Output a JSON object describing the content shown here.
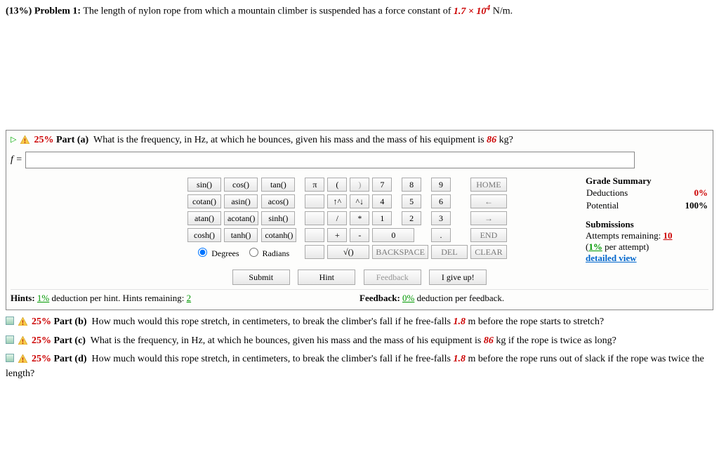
{
  "problem": {
    "weight": "(13%)",
    "label": "Problem 1:",
    "text_before": "The length of nylon rope from which a mountain climber is suspended has a force constant of",
    "constant": "1.7 × 10",
    "constant_exp": "4",
    "text_after": "N/m."
  },
  "part_a": {
    "pct": "25%",
    "label": "Part (a)",
    "question_before": "What is the frequency, in Hz, at which he bounces, given his mass and the mass of his equipment is",
    "mass": "86",
    "question_after": "kg?",
    "lhs": "f =",
    "input_value": ""
  },
  "fn_buttons": [
    [
      "sin()",
      "cos()",
      "tan()"
    ],
    [
      "cotan()",
      "asin()",
      "acos()"
    ],
    [
      "atan()",
      "acotan()",
      "sinh()"
    ],
    [
      "cosh()",
      "tanh()",
      "cotanh()"
    ]
  ],
  "deg_label": "Degrees",
  "rad_label": "Radians",
  "sym_col": [
    "π",
    "",
    "",
    "+"
  ],
  "paren_col": [
    "(",
    "↑^",
    "/",
    "-"
  ],
  "paren2_col": [
    ")",
    "^↓",
    "*",
    ""
  ],
  "num_grid": [
    [
      "7",
      "8",
      "9"
    ],
    [
      "4",
      "5",
      "6"
    ],
    [
      "1",
      "2",
      "3"
    ],
    [
      "0",
      "",
      ""
    ]
  ],
  "dot": ".",
  "nav_col": [
    "HOME",
    "←",
    "→",
    "END"
  ],
  "bottom_row": {
    "sqrt": "√()",
    "back": "BACKSPACE",
    "del": "DEL",
    "clear": "CLEAR"
  },
  "actions": {
    "submit": "Submit",
    "hint": "Hint",
    "feedback": "Feedback",
    "giveup": "I give up!"
  },
  "grade": {
    "hdr": "Grade Summary",
    "ded_label": "Deductions",
    "ded_val": "0%",
    "pot_label": "Potential",
    "pot_val": "100%",
    "sub_hdr": "Submissions",
    "att_label": "Attempts remaining:",
    "att_val": "10",
    "per_label_open": "(",
    "per_val": "1%",
    "per_label_close": " per attempt)",
    "detail": "detailed view"
  },
  "hints": {
    "left_prefix": "Hints:",
    "left_pct": "1%",
    "left_mid": "deduction per hint. Hints remaining:",
    "left_remaining": "2",
    "right_prefix": "Feedback:",
    "right_pct": "0%",
    "right_suffix": "deduction per feedback."
  },
  "part_b": {
    "pct": "25%",
    "label": "Part (b)",
    "q1": "How much would this rope stretch, in centimeters, to break the climber's fall if he free-falls",
    "val": "1.8",
    "q2": "m before the rope starts to stretch?"
  },
  "part_c": {
    "pct": "25%",
    "label": "Part (c)",
    "q1": "What is the frequency, in Hz, at which he bounces, given his mass and the mass of his equipment is",
    "val": "86",
    "q2": "kg if the rope is twice as long?"
  },
  "part_d": {
    "pct": "25%",
    "label": "Part (d)",
    "q1": "How much would this rope stretch, in centimeters, to break the climber's fall if he free-falls",
    "val": "1.8",
    "q2": "m before the rope runs out of slack if the rope was twice the length?"
  }
}
